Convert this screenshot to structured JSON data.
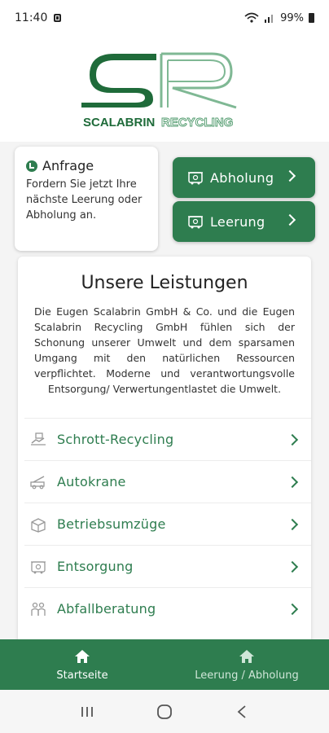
{
  "status_bar": {
    "time": "11:40",
    "battery": "99%",
    "notification_icon": "sim-icon",
    "signal_icons": [
      "wifi-icon",
      "signal-icon"
    ],
    "battery_icon": "battery-icon"
  },
  "logo": {
    "brand_left": "SCALABRIN",
    "brand_right": "RECYCLING",
    "monogram": "SR"
  },
  "request_card": {
    "icon": "info-check-icon",
    "title": "Anfrage",
    "text": "Fordern Sie jetzt Ihre nächste Leerung oder Abholung an."
  },
  "actions": [
    {
      "label": "Abholung",
      "icon": "bin-icon"
    },
    {
      "label": "Leerung",
      "icon": "bin-icon"
    }
  ],
  "services": {
    "title": "Unsere Leistungen",
    "description": "Die Eugen Scalabrin GmbH & Co. und die Eugen Scalabrin Recycling GmbH fühlen sich der Schonung unserer Umwelt und dem sparsamen Umgang mit den natürlichen Ressourcen verpflichtet. Moderne und verantwortungsvolle Entsorgung/ Verwertungentlastet die Umwelt.",
    "items": [
      {
        "label": "Schrott-Recycling",
        "icon": "recycling-hand-icon"
      },
      {
        "label": "Autokrane",
        "icon": "crane-truck-icon"
      },
      {
        "label": "Betriebsumzüge",
        "icon": "box-icon"
      },
      {
        "label": "Entsorgung",
        "icon": "bin-icon"
      },
      {
        "label": "Abfallberatung",
        "icon": "consulting-people-icon"
      }
    ]
  },
  "bottom_nav": {
    "items": [
      {
        "label": "Startseite",
        "icon": "home-icon",
        "active": true
      },
      {
        "label": "Leerung / Abholung",
        "icon": "home-icon",
        "active": false
      }
    ]
  },
  "colors": {
    "primary": "#2e7d4f",
    "logo_dark": "#1f6b3a"
  }
}
